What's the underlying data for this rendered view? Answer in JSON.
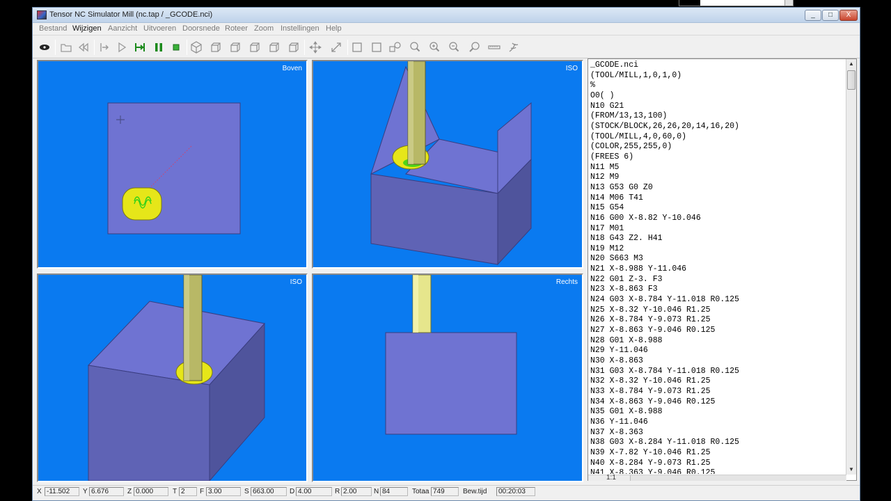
{
  "window": {
    "title": "Tensor NC Simulator Mill (nc.tap / _GCODE.nci)",
    "controls": [
      "_",
      "□",
      "X"
    ]
  },
  "menu": [
    "Bestand",
    "Wijzigen",
    "Aanzicht",
    "Uitvoeren",
    "Doorsnede",
    "Roteer",
    "Zoom",
    "Instellingen",
    "Help"
  ],
  "menu_active": "Wijzigen",
  "toolbar": {
    "icons": [
      "view-eye-icon",
      "open-file-icon",
      "rewind-icon",
      "to-start-icon",
      "play-icon",
      "step-icon",
      "pause-icon",
      "stop-icon",
      "iso-view-icon",
      "front-view-icon",
      "back-view-icon",
      "left-view-icon",
      "right-view-icon",
      "top-view-icon",
      "pan-icon",
      "move-icon",
      "zoom-window-icon",
      "zoom-box-icon",
      "zoom-fit-icon",
      "zoom-icon",
      "zoom-in-icon",
      "zoom-out-icon",
      "rotate-icon",
      "measure-icon",
      "settings-icon"
    ]
  },
  "viewports": {
    "top_left": {
      "label": "Boven"
    },
    "top_right": {
      "label": "ISO"
    },
    "bottom_left": {
      "label": "ISO"
    },
    "bottom_right": {
      "label": "Rechts"
    }
  },
  "colors": {
    "viewport_bg": "#0a7af0",
    "stock_top": "#6f73d2",
    "stock_front": "#5f63b5",
    "stock_side": "#4f549c",
    "tool": "#b8b866",
    "pocket": "#e6e619",
    "toolpath": "#35d018"
  },
  "code_lines": [
    "_GCODE.nci",
    "(TOOL/MILL,1,0,1,0)",
    "%",
    "O0( )",
    "N10 G21",
    "(FROM/13,13,100)",
    "(STOCK/BLOCK,26,26,20,14,16,20)",
    "(TOOL/MILL,4,0,60,0)",
    "(COLOR,255,255,0)",
    "(FREES 6)",
    "N11 M5",
    "N12 M9",
    "N13 G53 G0 Z0",
    "N14 M06 T41",
    "N15 G54",
    "N16 G00 X-8.82 Y-10.046",
    "N17 M01",
    "N18 G43 Z2. H41",
    "N19 M12",
    "N20 S663 M3",
    "N21 X-8.988 Y-11.046",
    "N22 G01 Z-3. F3",
    "N23 X-8.863 F3",
    "N24 G03 X-8.784 Y-11.018 R0.125",
    "N25 X-8.32 Y-10.046 R1.25",
    "N26 X-8.784 Y-9.073 R1.25",
    "N27 X-8.863 Y-9.046 R0.125",
    "N28 G01 X-8.988",
    "N29 Y-11.046",
    "N30 X-8.863",
    "N31 G03 X-8.784 Y-11.018 R0.125",
    "N32 X-8.32 Y-10.046 R1.25",
    "N33 X-8.784 Y-9.073 R1.25",
    "N34 X-8.863 Y-9.046 R0.125",
    "N35 G01 X-8.988",
    "N36 Y-11.046",
    "N37 X-8.363",
    "N38 G03 X-8.284 Y-11.018 R0.125",
    "N39 X-7.82 Y-10.046 R1.25",
    "N40 X-8.284 Y-9.073 R1.25",
    "N41 X-8.363 Y-9.046 R0.125"
  ],
  "code_footer": {
    "ratio": "1:1"
  },
  "status": {
    "x_label": "X",
    "x_value": "-11.502",
    "y_label": "Y",
    "y_value": "6.676",
    "z_label": "Z",
    "z_value": "0.000",
    "t_label": "T",
    "t_value": "2",
    "f_label": "F",
    "f_value": "3.00",
    "s_label": "S",
    "s_value": "663.00",
    "d_label": "D",
    "d_value": "4.00",
    "r_label": "R",
    "r_value": "2.00",
    "n_label": "N",
    "n_value": "84",
    "totaal_label": "Totaa",
    "totaal_value": "749",
    "bewtijd_label": "Bew.tijd",
    "bewtijd_value": "00:20:03"
  }
}
